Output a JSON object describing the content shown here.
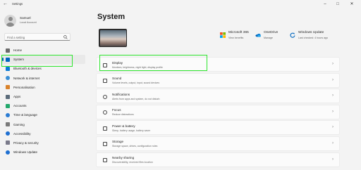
{
  "window": {
    "title": "Settings",
    "back_icon": "back-arrow-icon",
    "controls": [
      "minimize-icon",
      "maximize-icon",
      "close-icon"
    ]
  },
  "user": {
    "name": "Samuel",
    "account": "Local Account"
  },
  "search": {
    "placeholder": "Find a setting"
  },
  "sidebar": {
    "items": [
      {
        "label": "Home",
        "icon": "home-icon",
        "color": "#6b6b6b"
      },
      {
        "label": "System",
        "icon": "monitor-icon",
        "color": "#0067c0",
        "selected": true
      },
      {
        "label": "Bluetooth & devices",
        "icon": "bluetooth-icon",
        "color": "#0a7bd6"
      },
      {
        "label": "Network & internet",
        "icon": "wifi-icon",
        "color": "#3a8fd6"
      },
      {
        "label": "Personalisation",
        "icon": "brush-icon",
        "color": "#d9822b"
      },
      {
        "label": "Apps",
        "icon": "apps-icon",
        "color": "#5b6b7a"
      },
      {
        "label": "Accounts",
        "icon": "person-icon",
        "color": "#23a86b"
      },
      {
        "label": "Time & language",
        "icon": "globe-clock-icon",
        "color": "#2b7cd3"
      },
      {
        "label": "Gaming",
        "icon": "controller-icon",
        "color": "#7a7a7a"
      },
      {
        "label": "Accessibility",
        "icon": "accessibility-icon",
        "color": "#1f6fd1"
      },
      {
        "label": "Privacy & security",
        "icon": "shield-icon",
        "color": "#7a7a8a"
      },
      {
        "label": "Windows Update",
        "icon": "update-icon",
        "color": "#1f6fd1"
      }
    ]
  },
  "main": {
    "title": "System",
    "widgets": [
      {
        "title": "Microsoft 365",
        "subtitle": "View benefits",
        "icon": "microsoft-logo-icon"
      },
      {
        "title": "OneDrive",
        "subtitle": "Manage",
        "icon": "onedrive-cloud-icon"
      },
      {
        "title": "Windows Update",
        "subtitle": "Last checked: 4 hours ago",
        "icon": "update-icon"
      }
    ],
    "cards": [
      {
        "title": "Display",
        "subtitle": "Monitors, brightness, night light, display profile",
        "icon": "display-icon"
      },
      {
        "title": "Sound",
        "subtitle": "Volume levels, output, input, sound devices",
        "icon": "speaker-icon"
      },
      {
        "title": "Notifications",
        "subtitle": "Alerts from apps and system, do not disturb",
        "icon": "bell-icon"
      },
      {
        "title": "Focus",
        "subtitle": "Reduce distractions",
        "icon": "focus-icon"
      },
      {
        "title": "Power & battery",
        "subtitle": "Sleep, battery usage, battery saver",
        "icon": "power-icon"
      },
      {
        "title": "Storage",
        "subtitle": "Storage space, drives, configuration rules",
        "icon": "storage-icon"
      },
      {
        "title": "Nearby sharing",
        "subtitle": "Discoverability, received files location",
        "icon": "share-icon"
      }
    ]
  },
  "colors": {
    "accent": "#005fb8",
    "highlight": "#2ee52e",
    "background": "#f3f3f3",
    "card": "#fbfbfb"
  }
}
